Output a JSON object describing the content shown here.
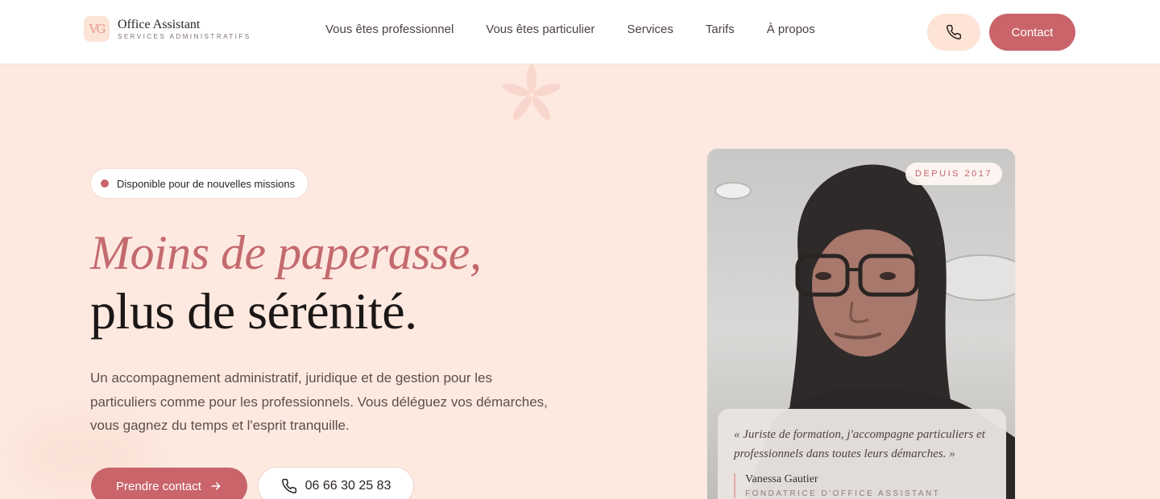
{
  "header": {
    "logo": {
      "mark": "VG",
      "title": "Office Assistant",
      "subtitle": "SERVICES ADMINISTRATIFS"
    },
    "nav": [
      {
        "label": "Vous êtes professionnel"
      },
      {
        "label": "Vous êtes particulier"
      },
      {
        "label": "Services"
      },
      {
        "label": "Tarifs"
      },
      {
        "label": "À propos"
      }
    ],
    "phone_icon": "phone-icon",
    "contact_label": "Contact"
  },
  "hero": {
    "badge": "Disponible pour de nouvelles missions",
    "title_italic": "Moins de paperasse,",
    "title_regular": "plus de sérénité.",
    "lead": "Un accompagnement administratif, juridique et de gestion pour les particuliers comme pour les professionnels. Vous déléguez vos démarches, vous gagnez du temps et l'esprit tranquille.",
    "cta_primary": "Prendre contact",
    "cta_primary_icon": "arrow-right-icon",
    "cta_phone": "06 66 30 25 83",
    "cta_phone_icon": "phone-icon"
  },
  "portrait": {
    "since_badge": "DEPUIS 2017",
    "quote": "« Juriste de formation, j'accompagne particuliers et professionnels dans toutes leurs démarches. »",
    "author_name": "Vanessa Gautier",
    "author_role": "FONDATRICE D'OFFICE ASSISTANT"
  },
  "colors": {
    "accent": "#c9646a",
    "background": "#fde9df",
    "heading_italic": "#c46a6f",
    "text": "#1c1717"
  }
}
